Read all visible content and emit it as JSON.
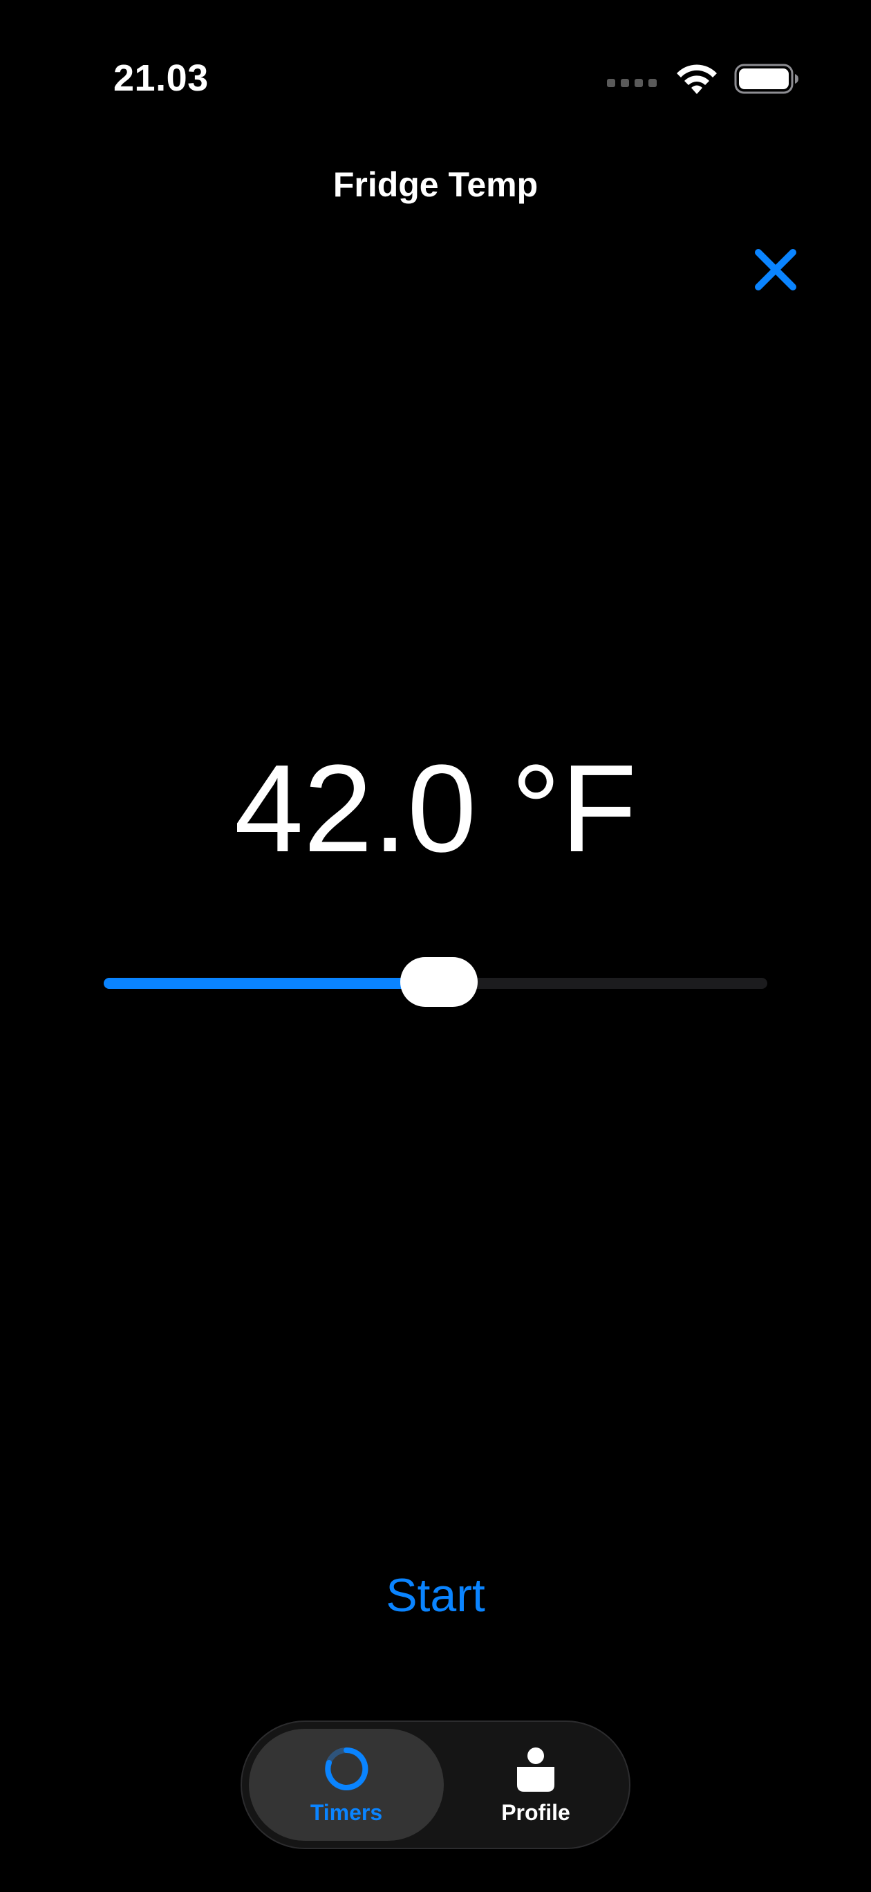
{
  "status_bar": {
    "time": "21.03",
    "icons": [
      "cellular-dots-icon",
      "wifi-icon",
      "battery-icon"
    ]
  },
  "header": {
    "title": "Fridge Temp",
    "close_icon": "close-icon"
  },
  "temperature": {
    "display": "42.0 °F",
    "slider_fraction": 0.505
  },
  "actions": {
    "start_label": "Start"
  },
  "tab_bar": {
    "tabs": [
      {
        "label": "Timers",
        "icon": "timer-ring-icon",
        "selected": true
      },
      {
        "label": "Profile",
        "icon": "person-icon",
        "selected": false
      }
    ]
  },
  "colors": {
    "accent": "#0a84ff",
    "background": "#000000",
    "text": "#ffffff"
  }
}
